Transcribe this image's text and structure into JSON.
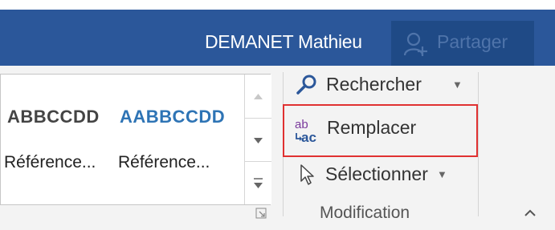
{
  "titlebar": {
    "user_name": "DEMANET Mathieu",
    "share_label": "Partager",
    "background": "#2b579a"
  },
  "styles_gallery": {
    "items": [
      {
        "preview": "ABBCCDD",
        "caption": "Référence..."
      },
      {
        "preview": "AABBCCDD",
        "caption": "Référence..."
      }
    ]
  },
  "editing_group": {
    "find_label": "Rechercher",
    "replace_label": "Remplacer",
    "select_label": "Sélectionner",
    "group_label": "Modification",
    "highlight_color": "#e03131"
  },
  "icons": {
    "share": "person-add-icon",
    "find": "search-icon",
    "replace": "replace-icon",
    "select": "cursor-arrow-icon",
    "launcher": "dialog-launcher-icon",
    "collapse": "chevron-up-icon"
  }
}
